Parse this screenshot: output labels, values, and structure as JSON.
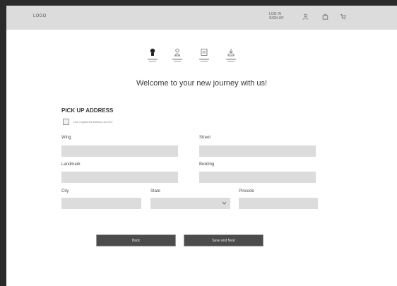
{
  "header": {
    "logo": "LOGO",
    "login": "LOG IN",
    "signup": "SIGN UP",
    "icons": [
      "user-icon",
      "bag-icon",
      "cart-icon"
    ]
  },
  "steps": [
    {
      "name": "step-1",
      "active": true
    },
    {
      "name": "step-2",
      "active": false
    },
    {
      "name": "step-3",
      "active": false
    },
    {
      "name": "step-4",
      "active": false
    }
  ],
  "welcome": "Welcome to your new journey with us!",
  "pickup": {
    "title": "PICK UP ADDRESS",
    "checkbox_label": "Use registered address as GST",
    "fields": {
      "wing": {
        "label": "Wing",
        "value": ""
      },
      "street": {
        "label": "Street",
        "value": ""
      },
      "landmark": {
        "label": "Landmark",
        "value": ""
      },
      "building": {
        "label": "Building",
        "value": ""
      },
      "city": {
        "label": "City",
        "value": ""
      },
      "state": {
        "label": "State",
        "value": ""
      },
      "pincode": {
        "label": "Pincode",
        "value": ""
      }
    }
  },
  "buttons": {
    "back": "Back",
    "save_next": "Save and Next"
  },
  "colors": {
    "page_bg": "#2b2b2b",
    "topbar": "#dcdcdc",
    "field": "#dcdcdc",
    "button": "#4c4c4c"
  }
}
